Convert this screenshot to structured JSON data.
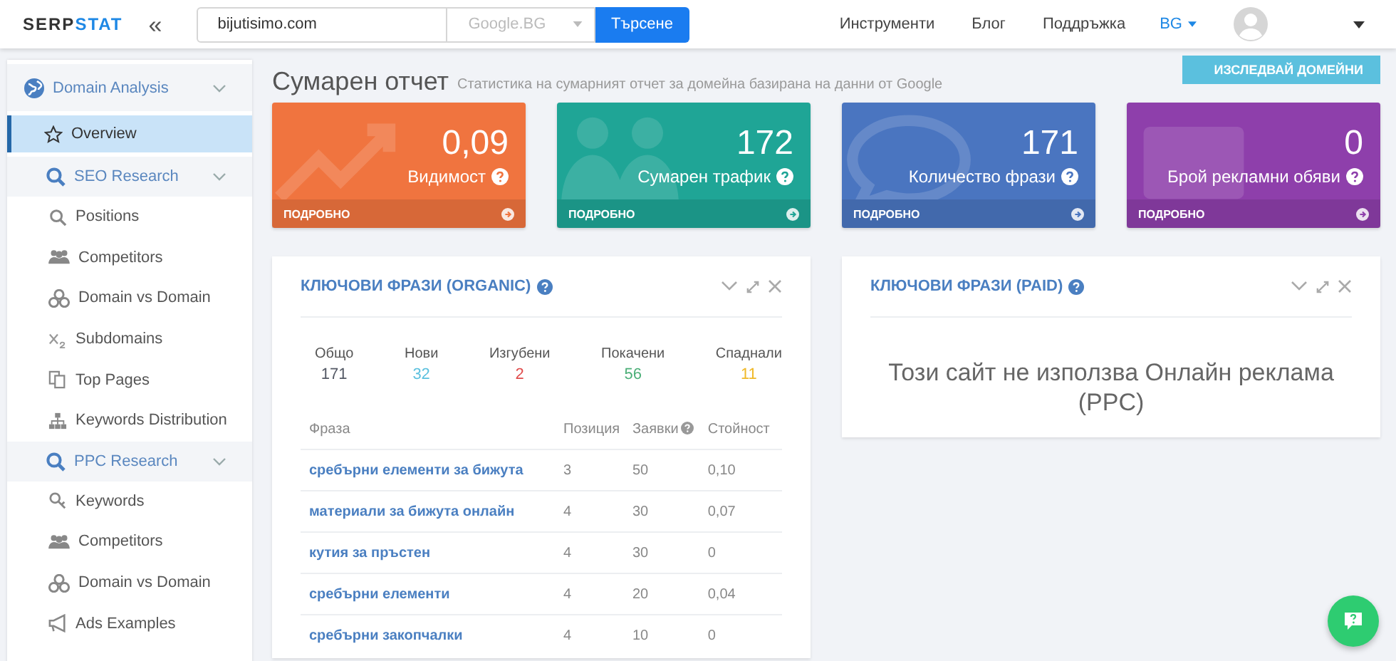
{
  "header": {
    "logo": {
      "part_1": "SERP",
      "part_2": "STAT"
    },
    "collapse_icon": "«",
    "search": {
      "value": "bijutisimo.com"
    },
    "engine": {
      "placeholder": "Google.BG"
    },
    "search_button": "Търсене",
    "nav": [
      "Инструменти",
      "Блог",
      "Поддръжка"
    ],
    "language": "BG"
  },
  "sidebar": {
    "sections": [
      {
        "title": "Domain Analysis",
        "expanded": true,
        "items": [
          {
            "label": "Overview",
            "selected": true
          }
        ]
      },
      {
        "title": "SEO Research",
        "expanded": true,
        "items": [
          {
            "label": "Positions",
            "selected": false
          },
          {
            "label": "Competitors",
            "selected": false
          },
          {
            "label": "Domain vs Domain",
            "selected": false
          },
          {
            "label": "Subdomains",
            "selected": false
          },
          {
            "label": "Top Pages",
            "selected": false
          },
          {
            "label": "Keywords Distribution",
            "selected": false
          }
        ]
      },
      {
        "title": "PPC Research",
        "expanded": true,
        "items": [
          {
            "label": "Keywords",
            "selected": false
          },
          {
            "label": "Competitors",
            "selected": false
          },
          {
            "label": "Domain vs Domain",
            "selected": false
          },
          {
            "label": "Ads Examples",
            "selected": false
          }
        ]
      }
    ]
  },
  "page": {
    "title": "Сумарен отчет",
    "subtitle": "Статистика на сумарният отчет за домейна базирана на данни от Google",
    "action_button": "ИЗСЛЕДВАЙ ДОМЕЙНИ"
  },
  "cards": [
    {
      "value": "0,09",
      "label": "Видимост",
      "footer": "ПОДРОБНО",
      "color": "#f0743f"
    },
    {
      "value": "172",
      "label": "Сумарен трафик",
      "footer": "ПОДРОБНО",
      "color": "#1fa596"
    },
    {
      "value": "171",
      "label": "Количество фрази",
      "footer": "ПОДРОБНО",
      "color": "#4a75c0"
    },
    {
      "value": "0",
      "label": "Брой рекламни обяви",
      "footer": "ПОДРОБНО",
      "color": "#8e3fab"
    }
  ],
  "organic": {
    "title": "КЛЮЧОВИ ФРАЗИ (ORGANIC)",
    "stats": [
      {
        "label": "Общо",
        "value": "171",
        "color": "#555a66"
      },
      {
        "label": "Нови",
        "value": "32",
        "color": "#5bc0de"
      },
      {
        "label": "Изгубени",
        "value": "2",
        "color": "#e04b4b"
      },
      {
        "label": "Покачени",
        "value": "56",
        "color": "#4caf78"
      },
      {
        "label": "Спаднали",
        "value": "11",
        "color": "#f0b92a"
      }
    ],
    "table": {
      "columns": [
        "Фраза",
        "Позиция",
        "Заявки",
        "Стойност"
      ],
      "rows": [
        [
          "сребърни елементи за бижута",
          "3",
          "50",
          "0,10"
        ],
        [
          "материали за бижута онлайн",
          "4",
          "30",
          "0,07"
        ],
        [
          "кутия за пръстен",
          "4",
          "30",
          "0"
        ],
        [
          "сребърни елементи",
          "4",
          "20",
          "0,04"
        ],
        [
          "сребърни закопчалки",
          "4",
          "10",
          "0"
        ]
      ]
    }
  },
  "paid": {
    "title": "КЛЮЧОВИ ФРАЗИ (PAID)",
    "message": "Този сайт не използва Онлайн реклама (PPC)"
  }
}
